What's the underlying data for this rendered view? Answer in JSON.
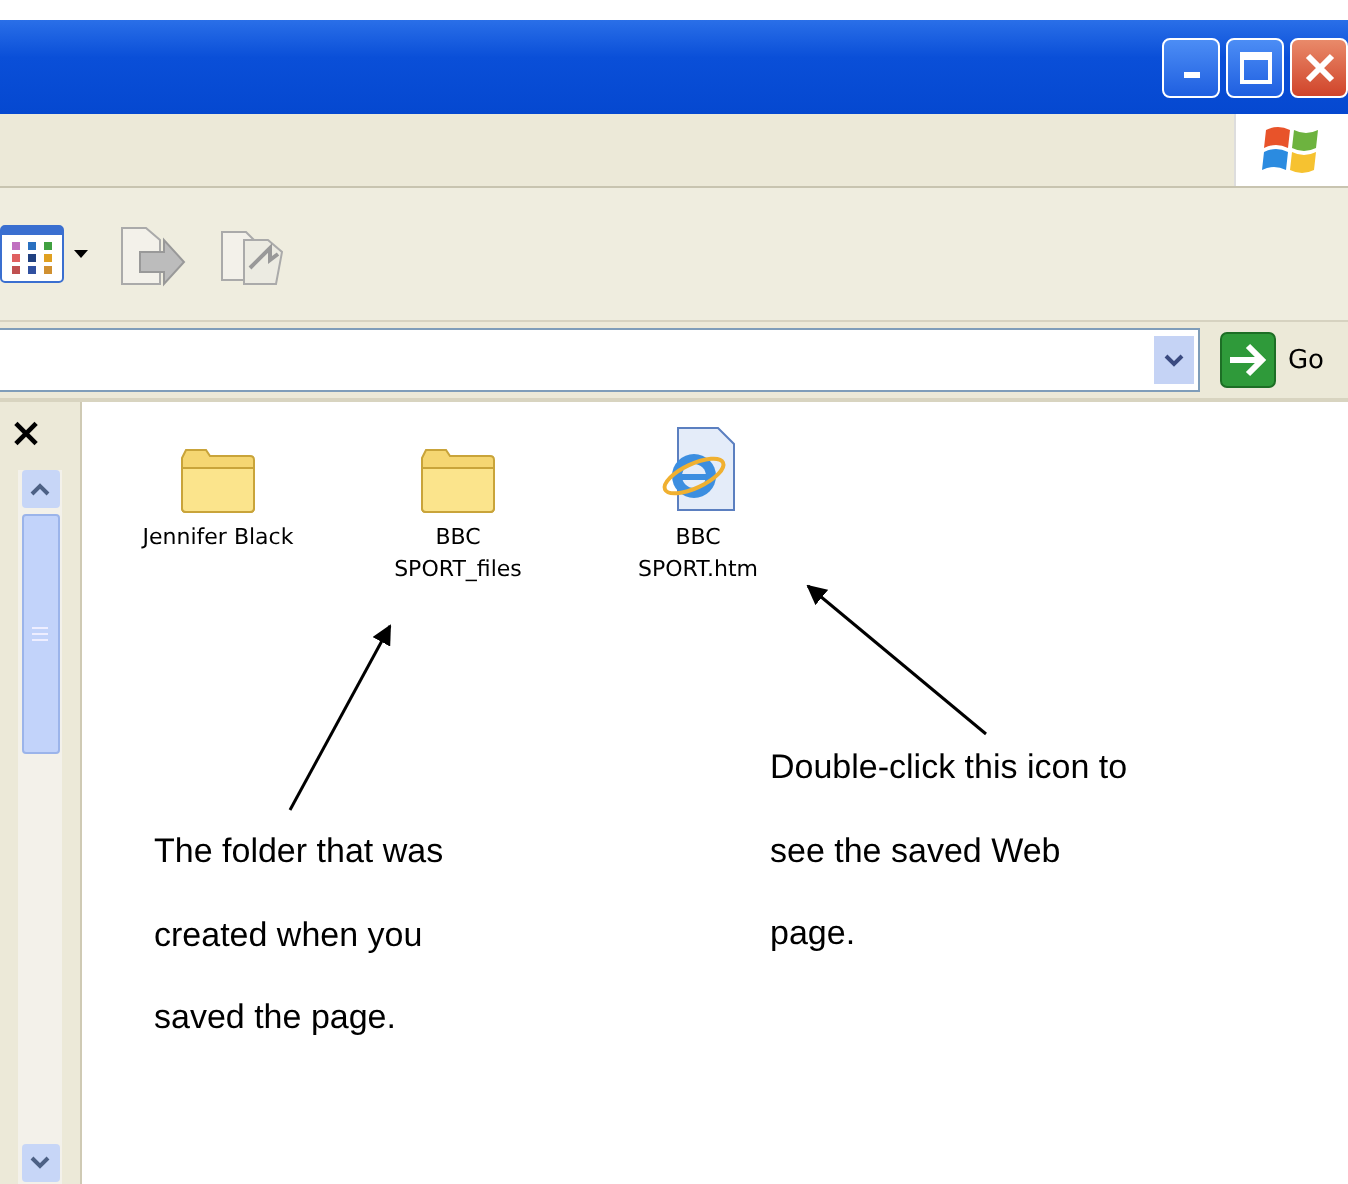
{
  "address_bar": {
    "go_button": "Go"
  },
  "left_pane": {
    "close_button": "×"
  },
  "files": [
    {
      "name": "Jennifer Black",
      "kind": "folder"
    },
    {
      "name": "BBC SPORT_files",
      "kind": "folder"
    },
    {
      "name": "BBC SPORT.htm",
      "kind": "web_page"
    }
  ],
  "annotations": [
    {
      "text": "The folder that was created when you saved the page."
    },
    {
      "text": "Double-click this icon to see the saved Web page."
    }
  ]
}
